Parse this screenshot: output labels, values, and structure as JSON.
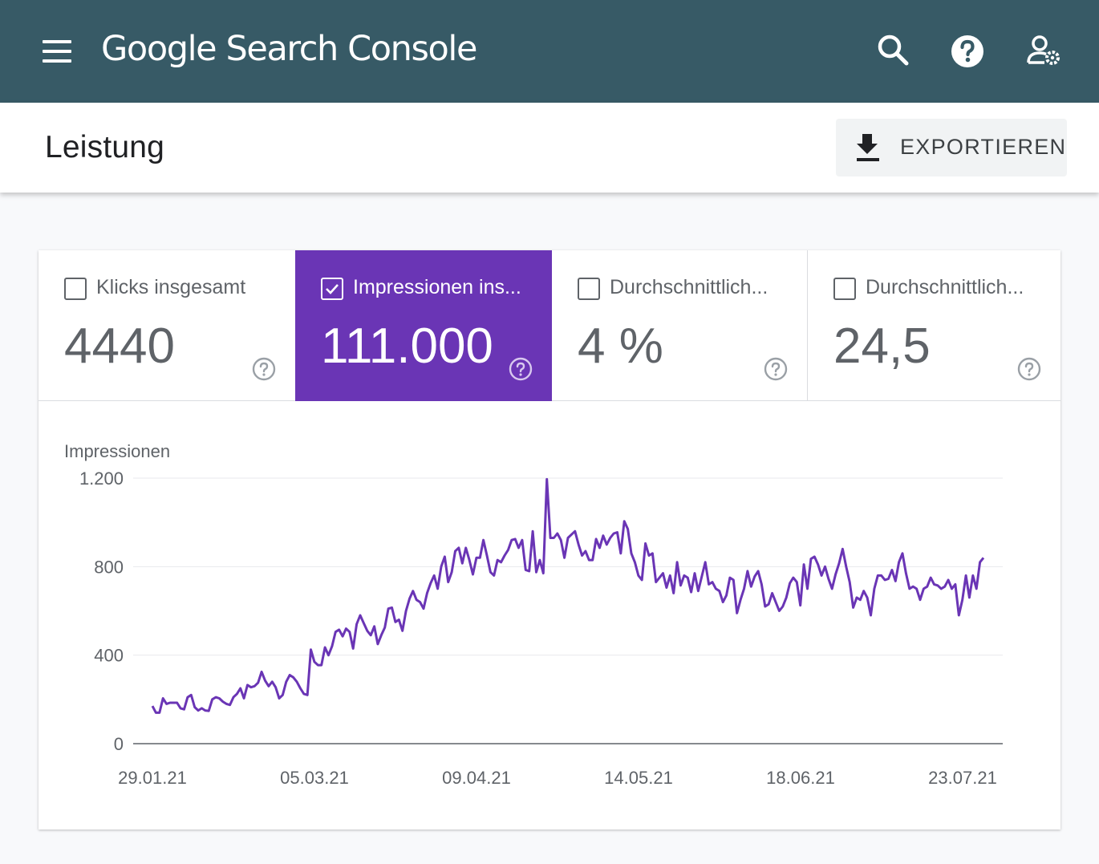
{
  "header": {
    "app_name": "Google Search Console",
    "menu_icon": "hamburger-menu-icon",
    "search_icon": "search-icon",
    "help_icon": "help-icon",
    "account_icon": "user-settings-icon"
  },
  "page": {
    "title": "Leistung",
    "export_label": "EXPORTIEREN",
    "export_icon": "download-icon"
  },
  "metrics": [
    {
      "label": "Klicks insgesamt",
      "value": "4440",
      "checked": false
    },
    {
      "label": "Impressionen ins...",
      "value": "111.000",
      "checked": true
    },
    {
      "label": "Durchschnittlich...",
      "value": "4 %",
      "checked": false
    },
    {
      "label": "Durchschnittlich...",
      "value": "24,5",
      "checked": false
    }
  ],
  "colors": {
    "topbar": "#375a66",
    "active_metric": "#6a35b5",
    "series_line": "#6a35b5"
  },
  "chart_data": {
    "type": "line",
    "title": "",
    "ylabel": "Impressionen",
    "xlabel": "",
    "ylim": [
      0,
      1200
    ],
    "y_ticks": [
      {
        "value": 0,
        "label": "0"
      },
      {
        "value": 400,
        "label": "400"
      },
      {
        "value": 800,
        "label": "800"
      },
      {
        "value": 1200,
        "label": "1.200"
      }
    ],
    "x_ticks": [
      "29.01.21",
      "05.03.21",
      "09.04.21",
      "14.05.21",
      "18.06.21",
      "23.07.21"
    ],
    "x_start_label": "29.01.21",
    "series": [
      {
        "name": "Impressionen",
        "values": [
          170,
          140,
          140,
          205,
          180,
          185,
          185,
          185,
          160,
          155,
          210,
          220,
          165,
          150,
          160,
          150,
          148,
          200,
          210,
          205,
          190,
          180,
          175,
          210,
          225,
          250,
          205,
          265,
          255,
          260,
          275,
          325,
          285,
          260,
          280,
          255,
          205,
          220,
          280,
          310,
          300,
          280,
          250,
          225,
          220,
          425,
          370,
          355,
          355,
          435,
          400,
          440,
          505,
          515,
          485,
          520,
          505,
          430,
          540,
          580,
          545,
          510,
          490,
          530,
          450,
          490,
          525,
          610,
          615,
          550,
          560,
          510,
          600,
          655,
          690,
          650,
          640,
          610,
          680,
          725,
          760,
          700,
          800,
          845,
          730,
          775,
          870,
          885,
          815,
          885,
          830,
          765,
          840,
          840,
          920,
          850,
          775,
          760,
          830,
          820,
          850,
          875,
          920,
          925,
          885,
          920,
          785,
          780,
          960,
          775,
          830,
          770,
          1195,
          930,
          930,
          950,
          920,
          840,
          930,
          945,
          960,
          900,
          850,
          870,
          830,
          830,
          925,
          885,
          940,
          900,
          930,
          950,
          955,
          860,
          1005,
          970,
          860,
          820,
          760,
          740,
          905,
          850,
          860,
          730,
          750,
          770,
          705,
          760,
          680,
          820,
          715,
          760,
          750,
          685,
          770,
          690,
          755,
          820,
          720,
          730,
          700,
          690,
          640,
          670,
          750,
          740,
          590,
          650,
          700,
          780,
          710,
          755,
          780,
          720,
          620,
          630,
          680,
          640,
          600,
          620,
          660,
          725,
          750,
          730,
          625,
          810,
          700,
          835,
          845,
          810,
          760,
          800,
          745,
          700,
          765,
          815,
          880,
          800,
          730,
          615,
          660,
          650,
          690,
          660,
          580,
          700,
          760,
          760,
          740,
          745,
          785,
          735,
          820,
          860,
          770,
          700,
          710,
          700,
          650,
          700,
          710,
          750,
          720,
          715,
          700,
          710,
          740,
          700,
          720,
          580,
          650,
          760,
          660,
          760,
          700,
          820,
          840
        ]
      }
    ],
    "grid": true,
    "legend": "none"
  }
}
